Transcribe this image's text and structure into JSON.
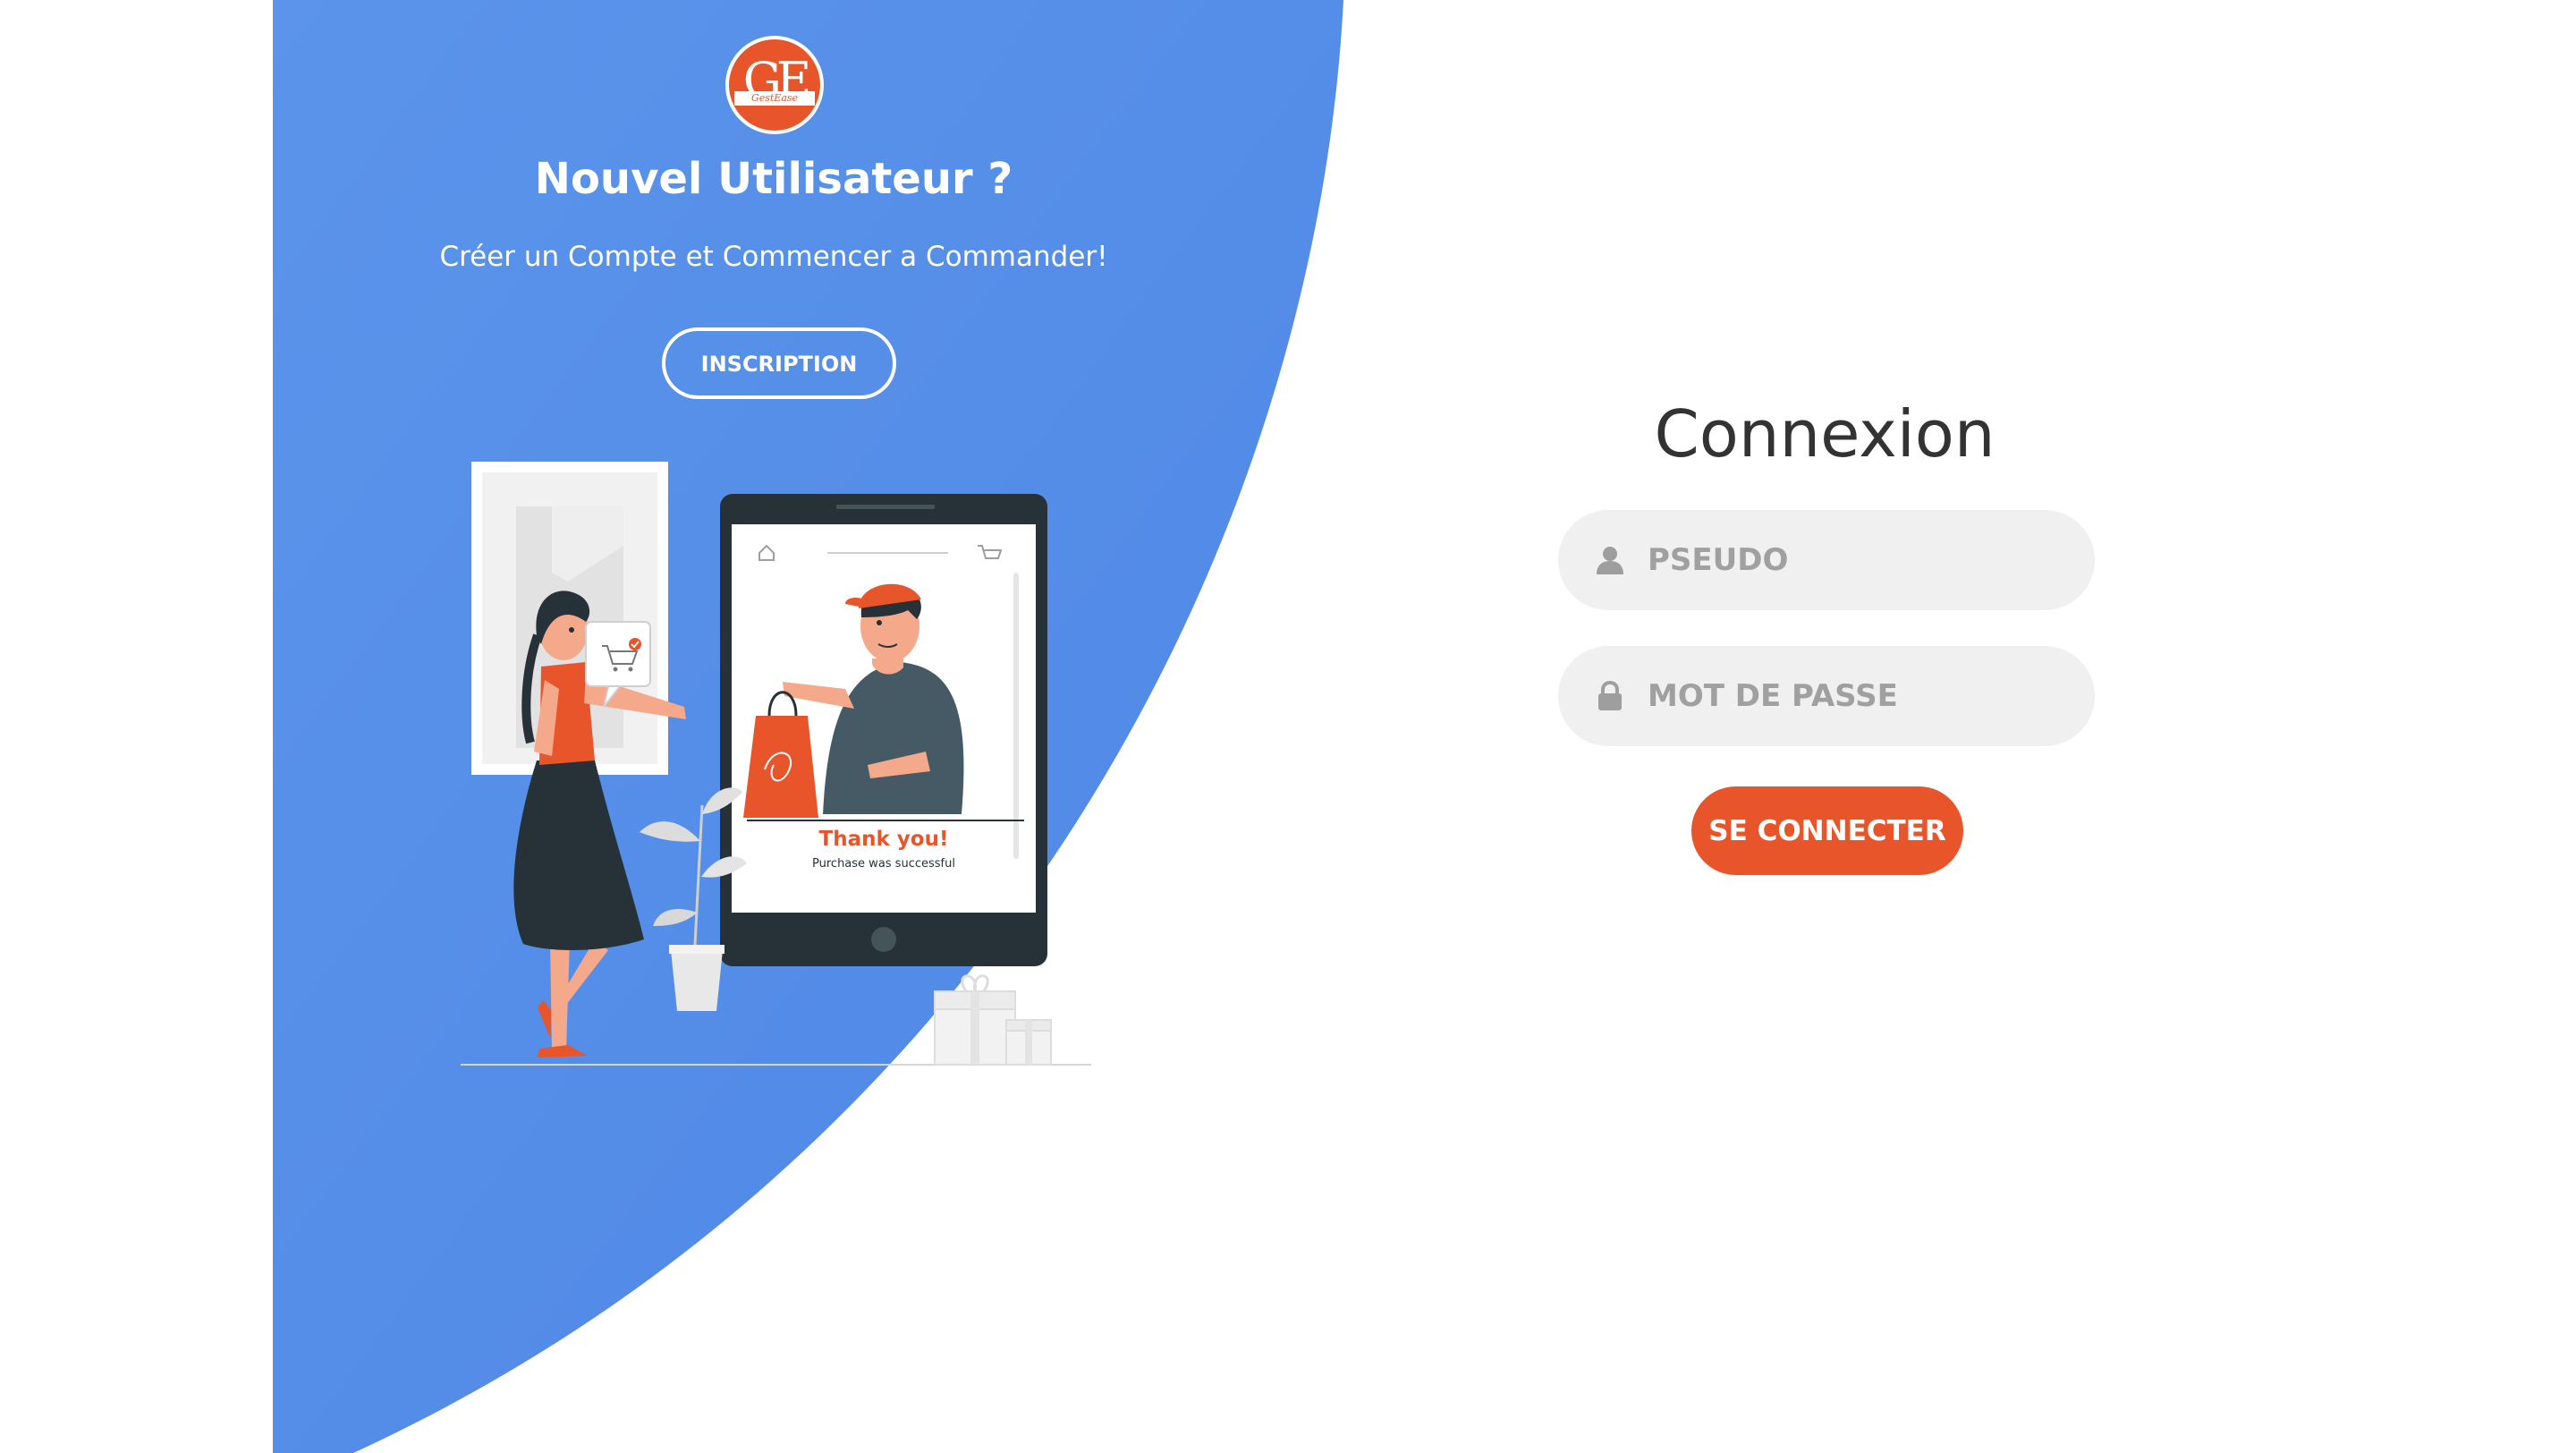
{
  "colors": {
    "panel_blue": "#5b94ea",
    "panel_blue_dark": "#4e87e6",
    "accent_orange": "#e8552b",
    "field_bg": "#f0f0f0",
    "title_text": "#333333",
    "placeholder_text": "#a0a0a0"
  },
  "left_panel": {
    "logo_text": "GE",
    "logo_subtext": "GestEase",
    "title": "Nouvel Utilisateur ?",
    "subtitle": "Créer un Compte et Commencer a Commander!",
    "signup_button": "INSCRIPTION",
    "illustration": {
      "thank_you": "Thank you!",
      "purchase_message": "Purchase was successful"
    }
  },
  "login_form": {
    "title": "Connexion",
    "username": {
      "placeholder": "PSEUDO",
      "value": "",
      "icon": "user-icon"
    },
    "password": {
      "placeholder": "MOT DE PASSE",
      "value": "",
      "icon": "lock-icon"
    },
    "submit_button": "SE CONNECTER"
  }
}
